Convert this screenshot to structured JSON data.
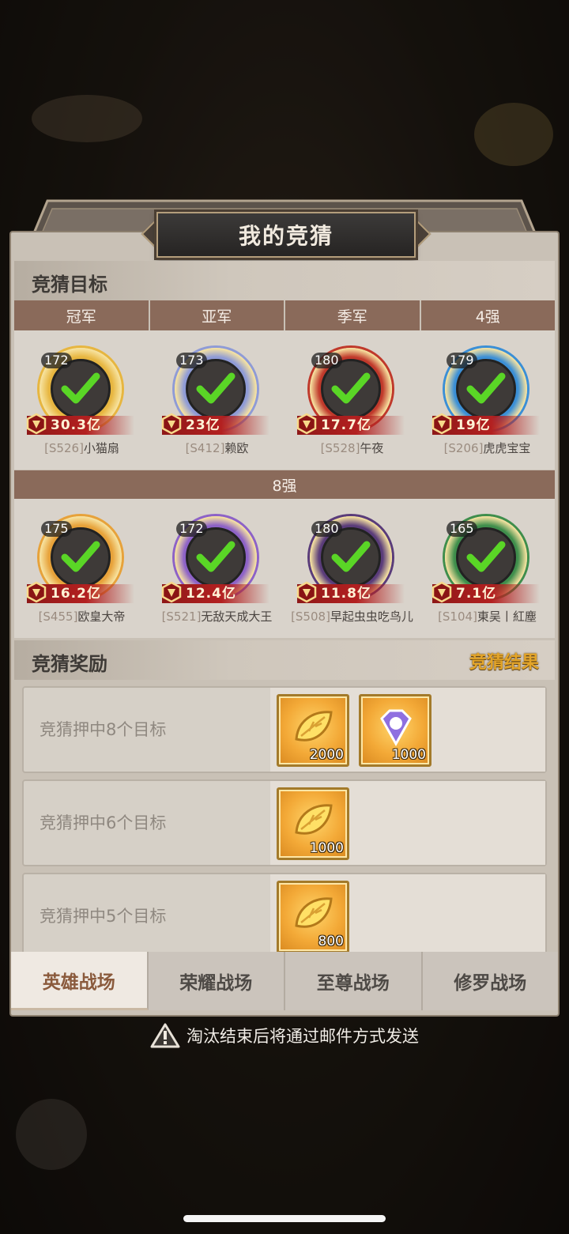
{
  "dialog": {
    "title": "我的竞猜"
  },
  "targets_section": {
    "title": "竞猜目标"
  },
  "columns": [
    "冠军",
    "亚军",
    "季军",
    "4强"
  ],
  "eight_label": "8强",
  "top_row": [
    {
      "level": "172",
      "power": "30.3亿",
      "server": "[S526]",
      "name": "小猫扇",
      "ring": "#e7b640"
    },
    {
      "level": "173",
      "power": "23亿",
      "server": "[S412]",
      "name": "赖欧",
      "ring": "#8f9bd6"
    },
    {
      "level": "180",
      "power": "17.7亿",
      "server": "[S528]",
      "name": "午夜",
      "ring": "#c0392b"
    },
    {
      "level": "179",
      "power": "19亿",
      "server": "[S206]",
      "name": "虎虎宝宝",
      "ring": "#3b8fd6"
    }
  ],
  "bottom_row": [
    {
      "level": "175",
      "power": "16.2亿",
      "server": "[S455]",
      "name": "欧皇大帝",
      "ring": "#e7a23a"
    },
    {
      "level": "172",
      "power": "12.4亿",
      "server": "[S521]",
      "name": "无敌天成大王",
      "ring": "#8d62c7"
    },
    {
      "level": "180",
      "power": "11.8亿",
      "server": "[S508]",
      "name": "早起虫虫吃鸟儿",
      "ring": "#5a3c7a"
    },
    {
      "level": "165",
      "power": "7.1亿",
      "server": "[S104]",
      "name": "東吴丨紅塵",
      "ring": "#3f8e4c"
    }
  ],
  "rewards_section": {
    "title": "竞猜奖励",
    "result_link": "竞猜结果"
  },
  "rewards": [
    {
      "label": "竞猜押中8个目标",
      "items": [
        {
          "icon": "gold-leaf-icon",
          "count": "2000"
        },
        {
          "icon": "crystal-icon",
          "count": "1000"
        }
      ]
    },
    {
      "label": "竞猜押中6个目标",
      "items": [
        {
          "icon": "gold-leaf-icon",
          "count": "1000"
        }
      ]
    },
    {
      "label": "竞猜押中5个目标",
      "items": [
        {
          "icon": "gold-leaf-icon",
          "count": "800"
        }
      ]
    }
  ],
  "tabs": [
    "英雄战场",
    "荣耀战场",
    "至尊战场",
    "修罗战场"
  ],
  "notice": "淘汰结束后将通过邮件方式发送",
  "colors": {
    "column_header": "#8a6a5a",
    "power_bar": "#b32020",
    "check": "#5ad626",
    "accent": "#e3a52a"
  }
}
